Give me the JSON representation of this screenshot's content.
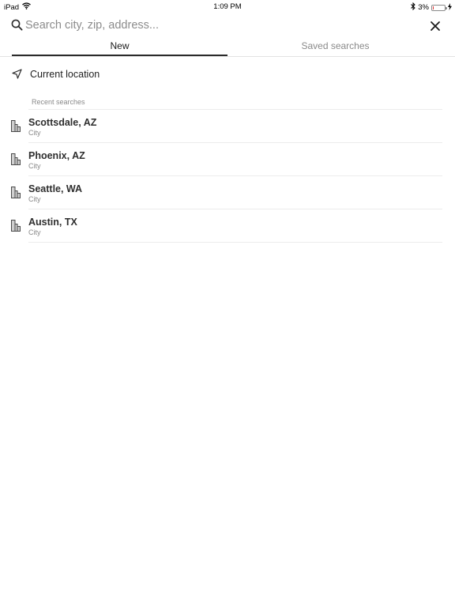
{
  "status_bar": {
    "device": "iPad",
    "time": "1:09 PM",
    "battery": "3%",
    "battery_level": 0.03
  },
  "search": {
    "placeholder": "Search city, zip, address...",
    "value": ""
  },
  "tabs": [
    {
      "label": "New",
      "active": true
    },
    {
      "label": "Saved searches",
      "active": false
    }
  ],
  "current_location": {
    "label": "Current location"
  },
  "recent": {
    "header": "Recent searches",
    "items": [
      {
        "title": "Scottsdale, AZ",
        "subtitle": "City"
      },
      {
        "title": "Phoenix, AZ",
        "subtitle": "City"
      },
      {
        "title": "Seattle, WA",
        "subtitle": "City"
      },
      {
        "title": "Austin, TX",
        "subtitle": "City"
      }
    ]
  },
  "icons": {
    "search": "search-icon",
    "close": "close-icon",
    "location": "location-arrow-icon",
    "building": "building-icon",
    "wifi": "wifi-icon",
    "bluetooth": "bluetooth-icon",
    "battery": "battery-icon",
    "charging": "charging-bolt-icon"
  },
  "colors": {
    "battery_low": "#e23b3b",
    "tab_active": "#2b2b2b",
    "muted": "#8a8a8a"
  }
}
